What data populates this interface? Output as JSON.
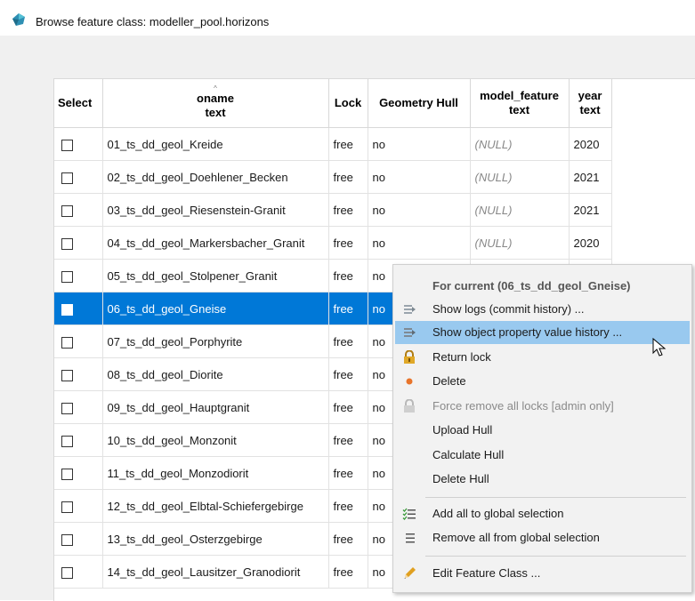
{
  "window": {
    "title": "Browse feature class: modeller_pool.horizons"
  },
  "table": {
    "columns": [
      {
        "line1": "Select",
        "line2": ""
      },
      {
        "line1": "oname",
        "line2": "text"
      },
      {
        "line1": "Lock",
        "line2": ""
      },
      {
        "line1": "Geometry Hull",
        "line2": ""
      },
      {
        "line1": "model_feature",
        "line2": "text"
      },
      {
        "line1": "year",
        "line2": "text"
      }
    ],
    "sort_indicator": "^",
    "rows": [
      {
        "oname": "01_ts_dd_geol_Kreide",
        "lock": "free",
        "hull": "no",
        "model": "(NULL)",
        "year": "2020"
      },
      {
        "oname": "02_ts_dd_geol_Doehlener_Becken",
        "lock": "free",
        "hull": "no",
        "model": "(NULL)",
        "year": "2021"
      },
      {
        "oname": "03_ts_dd_geol_Riesenstein-Granit",
        "lock": "free",
        "hull": "no",
        "model": "(NULL)",
        "year": "2021"
      },
      {
        "oname": "04_ts_dd_geol_Markersbacher_Granit",
        "lock": "free",
        "hull": "no",
        "model": "(NULL)",
        "year": "2020"
      },
      {
        "oname": "05_ts_dd_geol_Stolpener_Granit",
        "lock": "free",
        "hull": "no",
        "model": "",
        "year": ""
      },
      {
        "oname": "06_ts_dd_geol_Gneise",
        "lock": "free",
        "hull": "no",
        "model": "",
        "year": ""
      },
      {
        "oname": "07_ts_dd_geol_Porphyrite",
        "lock": "free",
        "hull": "no",
        "model": "",
        "year": ""
      },
      {
        "oname": "08_ts_dd_geol_Diorite",
        "lock": "free",
        "hull": "no",
        "model": "",
        "year": ""
      },
      {
        "oname": "09_ts_dd_geol_Hauptgranit",
        "lock": "free",
        "hull": "no",
        "model": "",
        "year": ""
      },
      {
        "oname": "10_ts_dd_geol_Monzonit",
        "lock": "free",
        "hull": "no",
        "model": "",
        "year": ""
      },
      {
        "oname": "11_ts_dd_geol_Monzodiorit",
        "lock": "free",
        "hull": "no",
        "model": "",
        "year": ""
      },
      {
        "oname": "12_ts_dd_geol_Elbtal-Schiefergebirge",
        "lock": "free",
        "hull": "no",
        "model": "",
        "year": ""
      },
      {
        "oname": "13_ts_dd_geol_Osterzgebirge",
        "lock": "free",
        "hull": "no",
        "model": "",
        "year": ""
      },
      {
        "oname": "14_ts_dd_geol_Lausitzer_Granodiorit",
        "lock": "free",
        "hull": "no",
        "model": "",
        "year": ""
      }
    ],
    "selected_row": 5
  },
  "context_menu": {
    "header": "For current (06_ts_dd_geol_Gneise)",
    "items": {
      "show_logs": "Show logs (commit history) ...",
      "show_history": "Show object property value history ...",
      "return_lock": "Return lock",
      "delete": "Delete",
      "force_remove": "Force remove all locks [admin only]",
      "upload_hull": "Upload Hull",
      "calculate_hull": "Calculate Hull",
      "delete_hull": "Delete Hull",
      "add_all": "Add all to global selection",
      "remove_all": "Remove all from global selection",
      "edit_fc": "Edit Feature Class ..."
    }
  },
  "colors": {
    "selection": "#0078d7",
    "menu_hover": "#99c9ef",
    "delete_dot": "#e8742a",
    "lock_icon": "#d9a21b",
    "pencil": "#e0a020"
  },
  "icons": [
    "app-icon",
    "checkbox",
    "log-icon",
    "history-icon",
    "lock-icon",
    "delete-dot-icon",
    "force-unlock-icon",
    "add-list-icon",
    "remove-list-icon",
    "pencil-icon",
    "mouse-cursor"
  ]
}
